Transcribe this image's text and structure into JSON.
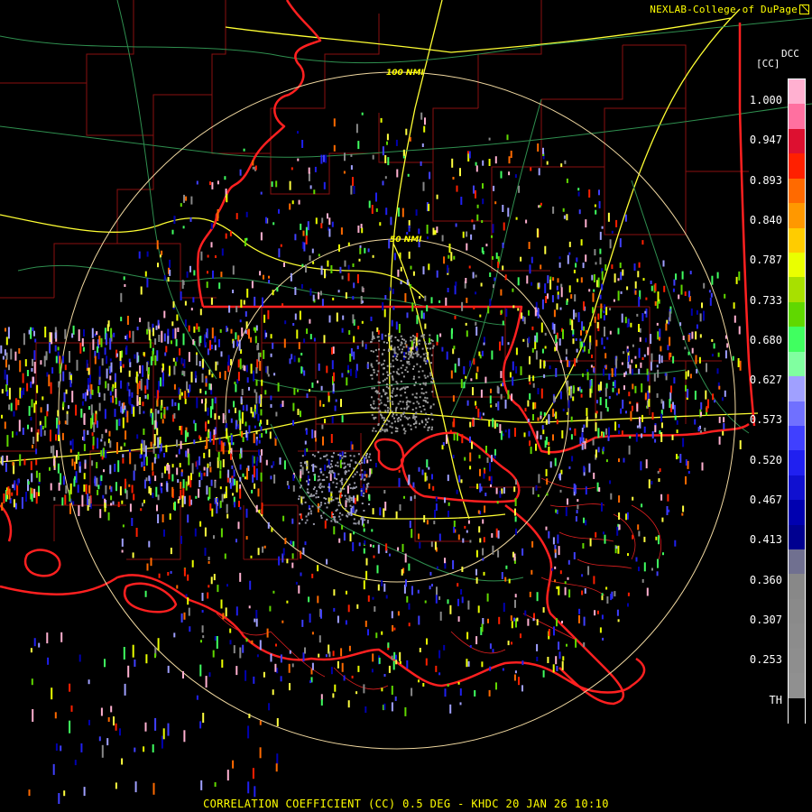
{
  "credit": "NEXLAB-College of DuPage",
  "legend": {
    "product": "DCC",
    "unit": "[CC]",
    "ticks": [
      "1.000",
      "0.947",
      "0.893",
      "0.840",
      "0.787",
      "0.733",
      "0.680",
      "0.627",
      "0.573",
      "0.520",
      "0.467",
      "0.413",
      "0.360",
      "0.307",
      "0.253",
      "TH"
    ],
    "colors": [
      "#ffb0d0",
      "#ff70a0",
      "#dd1030",
      "#ff2000",
      "#ff6a00",
      "#ff9800",
      "#ffcc00",
      "#eaff00",
      "#a8e000",
      "#60d800",
      "#40ff60",
      "#80ffa0",
      "#a0a0ff",
      "#7070ff",
      "#4040ff",
      "#2020f0",
      "#1010d0",
      "#0000b0",
      "#000090",
      "#707090",
      "#888888",
      "#8a8a8a",
      "#8c8c8c",
      "#8e8e8e",
      "#909090",
      "#000000"
    ]
  },
  "range_rings": [
    {
      "label": "100 NMI"
    },
    {
      "label": "50 NMI"
    }
  ],
  "caption": "CORRELATION COEFFICIENT (CC) 0.5 DEG - KHDC 20 JAN 26 10:10"
}
